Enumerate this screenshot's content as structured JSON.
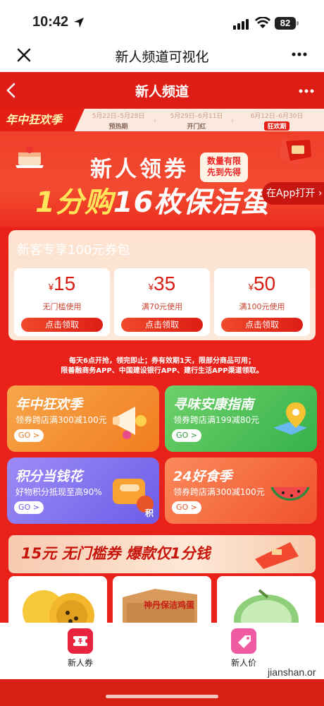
{
  "status": {
    "time": "10:42",
    "battery": "82"
  },
  "header": {
    "title": "新人频道可视化"
  },
  "app": {
    "title": "新人频道",
    "timeline": {
      "logo": "年中狂欢季",
      "stages": [
        {
          "dates": "5月22日–5月28日",
          "name": "预热期"
        },
        {
          "dates": "5月29日–6月11日",
          "name": "开门红"
        },
        {
          "dates": "6月12日–6月30日",
          "name": "狂欢期"
        }
      ]
    },
    "banner": {
      "title": "新人领券",
      "badge_line1": "数量有限",
      "badge_line2": "先到先得",
      "sub_part1": "1分购",
      "sub_part2": "16枚保洁蛋",
      "open_app": "在App打开"
    },
    "coupon_pack": {
      "title": "新客专享100元券包",
      "coupons": [
        {
          "symbol": "¥",
          "amount": "15",
          "condition": "无门槛使用",
          "button": "点击领取"
        },
        {
          "symbol": "¥",
          "amount": "35",
          "condition": "满70元使用",
          "button": "点击领取"
        },
        {
          "symbol": "¥",
          "amount": "50",
          "condition": "满100元使用",
          "button": "点击领取"
        }
      ]
    },
    "notes": [
      "每天6点开抢，领完即止；券有效期1天，限部分商品可用；",
      "限善融商务APP、中国建设银行APP、建行生活APP渠道领取。"
    ],
    "tiles": [
      {
        "title": "年中狂欢季",
        "subtitle": "领券跨店满300减100元",
        "go": "GO >"
      },
      {
        "title": "寻味安康指南",
        "subtitle": "领券跨店满199减80元",
        "go": "GO >"
      },
      {
        "title": "积分当钱花",
        "subtitle": "好物积分抵现至高90%",
        "go": "GO >"
      },
      {
        "title": "24好食季",
        "subtitle": "领券跨店满300减100元",
        "go": "GO >"
      }
    ],
    "promo": {
      "part1": "15元",
      "part2": " 无门槛券  爆款仅",
      "part3": "1分钱"
    },
    "box_label": "神丹保洁鸡蛋",
    "tile_points": "积"
  },
  "tabbar": {
    "items": [
      {
        "label": "新人券"
      },
      {
        "label": "新人价"
      }
    ],
    "watermark": "jianshan.or"
  },
  "colors": {
    "brand_red": "#e8221a",
    "coupon_red": "#d91d12",
    "gold": "#ffe55a"
  }
}
